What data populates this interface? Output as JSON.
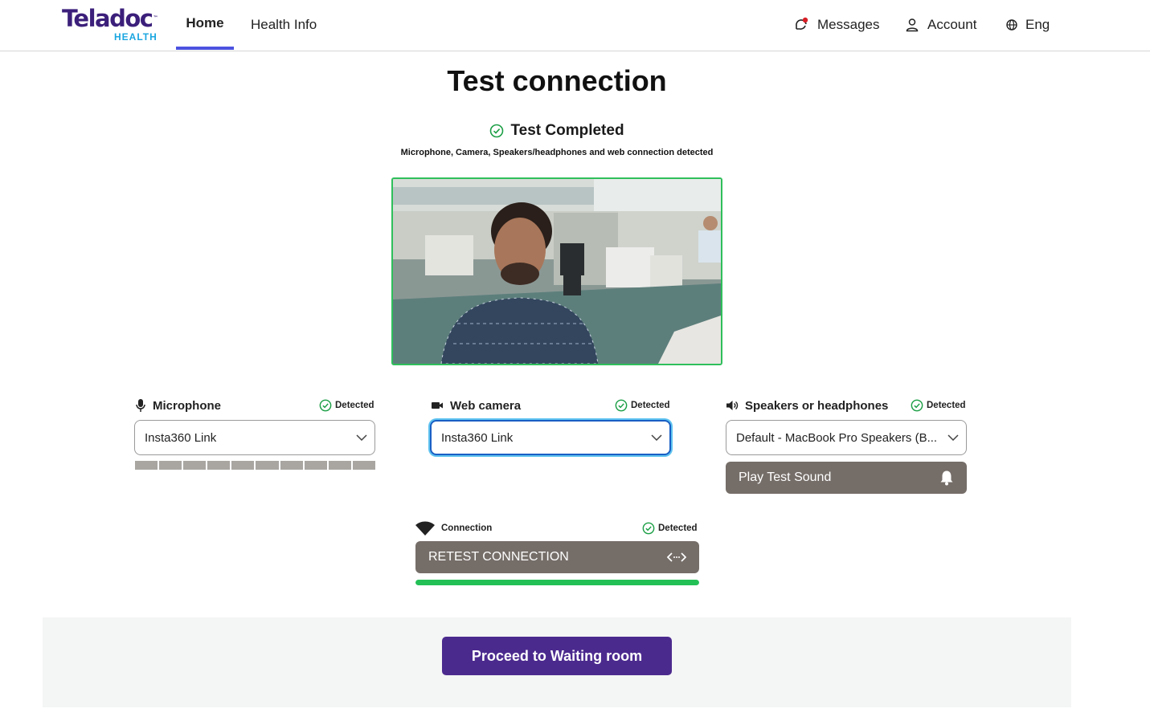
{
  "brand": {
    "name": "Teladoc",
    "sub": "HEALTH",
    "tm": "™"
  },
  "nav": {
    "home": "Home",
    "health_info": "Health Info"
  },
  "header_right": {
    "messages": "Messages",
    "account": "Account",
    "language": "Eng"
  },
  "page_title": "Test connection",
  "status": {
    "title": "Test Completed",
    "subtitle": "Microphone, Camera, Speakers/headphones and web connection detected"
  },
  "devices": {
    "microphone": {
      "label": "Microphone",
      "status": "Detected",
      "selected": "Insta360 Link",
      "meter_segments": 10
    },
    "camera": {
      "label": "Web camera",
      "status": "Detected",
      "selected": "Insta360 Link"
    },
    "speakers": {
      "label": "Speakers or headphones",
      "status": "Detected",
      "selected": "Default - MacBook Pro Speakers (B...",
      "play_label": "Play Test Sound"
    }
  },
  "connection": {
    "label": "Connection",
    "status": "Detected",
    "retest_label": "RETEST CONNECTION",
    "progress_fraction": 1.0
  },
  "proceed_label": "Proceed to Waiting room",
  "colors": {
    "accent_tab": "#4b52e0",
    "brand_purple": "#4b2a8e",
    "success_green": "#2fbf5b",
    "button_gray": "#756d68",
    "focus_blue": "#1a5fc4"
  },
  "icons": {
    "messages": "chat-bubble-icon",
    "account": "person-icon",
    "language": "globe-icon",
    "status": "check-circle-icon",
    "microphone": "microphone-icon",
    "camera": "video-camera-icon",
    "speakers": "speaker-icon",
    "play": "bell-icon",
    "connection": "wifi-icon",
    "retest": "code-arrows-icon"
  }
}
